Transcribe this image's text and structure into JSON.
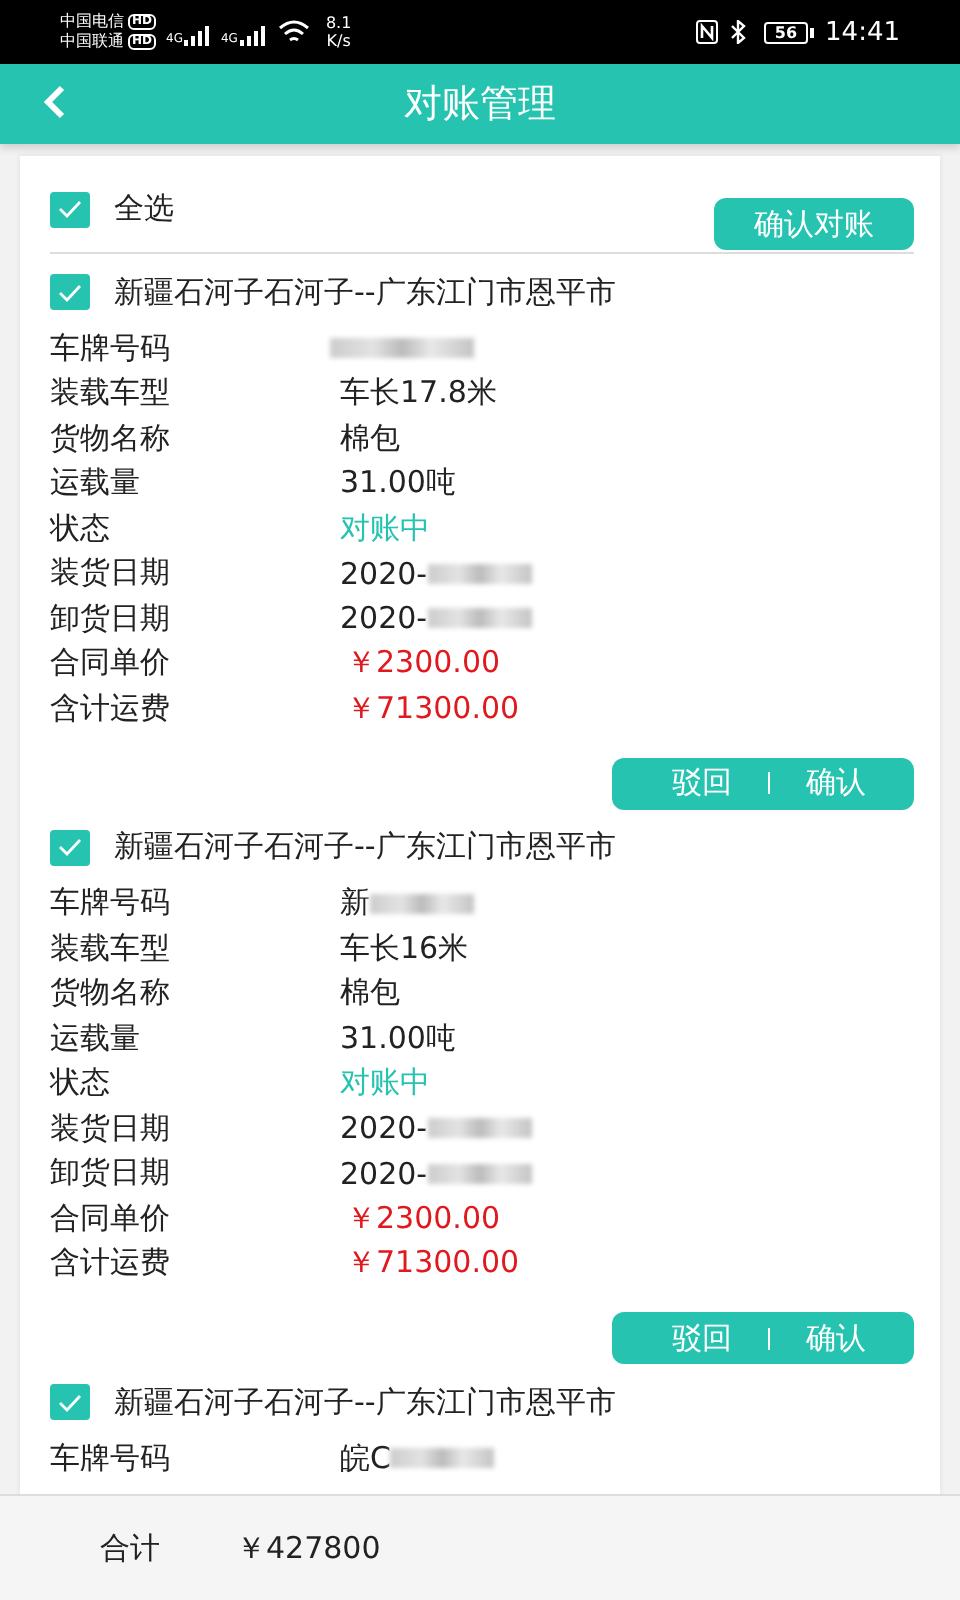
{
  "status_bar": {
    "carriers": [
      {
        "name": "中国电信",
        "badge": "HD"
      },
      {
        "name": "中国联通",
        "badge": "HD"
      }
    ],
    "signals": [
      {
        "network": "4G"
      },
      {
        "network": "4G"
      }
    ],
    "speed": {
      "value": "8.1",
      "unit": "K/s"
    },
    "battery": "56",
    "time": "14:41"
  },
  "header": {
    "title": "对账管理"
  },
  "select_all": {
    "label": "全选",
    "checked": true,
    "button": "确认对账"
  },
  "orders": [
    {
      "checked": true,
      "route": "新疆石河子石河子--广东江门市恩平市",
      "fields": [
        {
          "label": "车牌号码",
          "kind": "plain",
          "blurred": true
        },
        {
          "label": "装载车型",
          "kind": "plain",
          "value": "车长17.8米"
        },
        {
          "label": "货物名称",
          "kind": "plain",
          "value": "棉包"
        },
        {
          "label": "运载量",
          "kind": "plain",
          "value": "31.00吨"
        },
        {
          "label": "状态",
          "kind": "status",
          "value": "对账中"
        },
        {
          "label": "装货日期",
          "kind": "plain",
          "value": "2020-",
          "blurred": true
        },
        {
          "label": "卸货日期",
          "kind": "plain",
          "value": "2020-",
          "blurred": true
        },
        {
          "label": "合同单价",
          "kind": "price",
          "value": "￥2300.00"
        },
        {
          "label": "含计运费",
          "kind": "price",
          "value": "￥71300.00"
        }
      ],
      "actions": [
        "驳回",
        "确认"
      ]
    },
    {
      "checked": true,
      "route": "新疆石河子石河子--广东江门市恩平市",
      "fields": [
        {
          "label": "车牌号码",
          "kind": "plain",
          "value": "新",
          "blurred": true
        },
        {
          "label": "装载车型",
          "kind": "plain",
          "value": "车长16米"
        },
        {
          "label": "货物名称",
          "kind": "plain",
          "value": "棉包"
        },
        {
          "label": "运载量",
          "kind": "plain",
          "value": "31.00吨"
        },
        {
          "label": "状态",
          "kind": "status",
          "value": "对账中"
        },
        {
          "label": "装货日期",
          "kind": "plain",
          "value": "2020-",
          "blurred": true
        },
        {
          "label": "卸货日期",
          "kind": "plain",
          "value": "2020-",
          "blurred": true
        },
        {
          "label": "合同单价",
          "kind": "price",
          "value": "￥2300.00"
        },
        {
          "label": "含计运费",
          "kind": "price",
          "value": "￥71300.00"
        }
      ],
      "actions": [
        "驳回",
        "确认"
      ]
    },
    {
      "checked": true,
      "route": "新疆石河子石河子--广东江门市恩平市",
      "fields": [
        {
          "label": "车牌号码",
          "kind": "plain",
          "value": "皖C",
          "blurred": true
        }
      ]
    }
  ],
  "footer": {
    "label": "合计",
    "total": "￥427800"
  }
}
